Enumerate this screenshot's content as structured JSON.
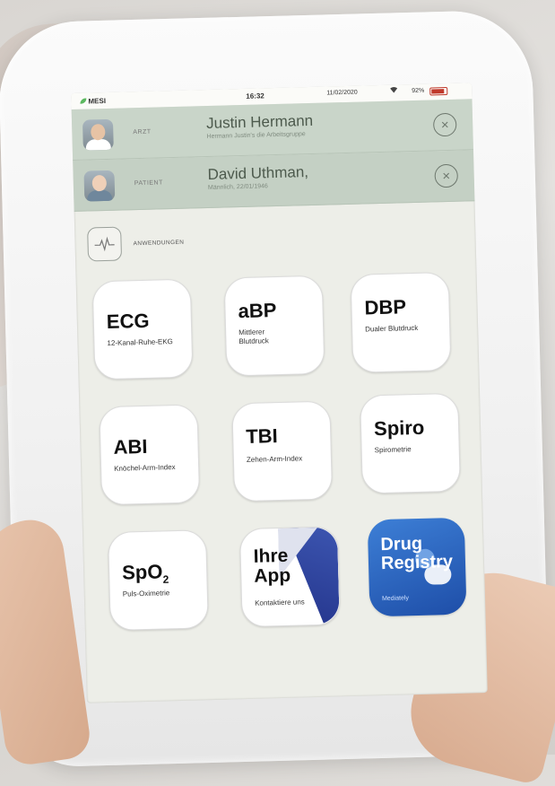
{
  "status": {
    "brand": "MESI",
    "time": "16:32",
    "date": "11/02/2020",
    "battery": "92%"
  },
  "doctor": {
    "role": "ARZT",
    "name": "Justin Hermann",
    "subtitle": "Hermann Justin's die Arbeitsgruppe",
    "close_icon": "×"
  },
  "patient": {
    "role": "PATIENT",
    "name": "David Uthman,",
    "subtitle": "Männlich, 22/01/1946",
    "close_icon": "×"
  },
  "apps_section": {
    "label": "ANWENDUNGEN"
  },
  "apps": [
    {
      "title": "ECG",
      "desc": "12-Kanal-Ruhe-EKG"
    },
    {
      "title": "aBP",
      "desc": "Mittlerer Blutdruck"
    },
    {
      "title": "DBP",
      "desc": "Dualer Blutdruck"
    },
    {
      "title": "ABI",
      "desc": "Knöchel-Arm-Index"
    },
    {
      "title": "TBI",
      "desc": "Zehen-Arm-Index"
    },
    {
      "title": "Spiro",
      "desc": "Spirometrie"
    },
    {
      "title": "SpO",
      "title_sub": "2",
      "desc": "Puls-Oximetrie"
    },
    {
      "title": "Ihre App",
      "desc": "Kontaktiere uns"
    },
    {
      "title": "Drug Registry",
      "desc": "Mediately"
    }
  ],
  "colors": {
    "header_bg": "#c9d5c9",
    "screen_bg": "#edeee8",
    "drug_tile": "#2a62c0",
    "fold_accent": "#2c3f9a"
  }
}
